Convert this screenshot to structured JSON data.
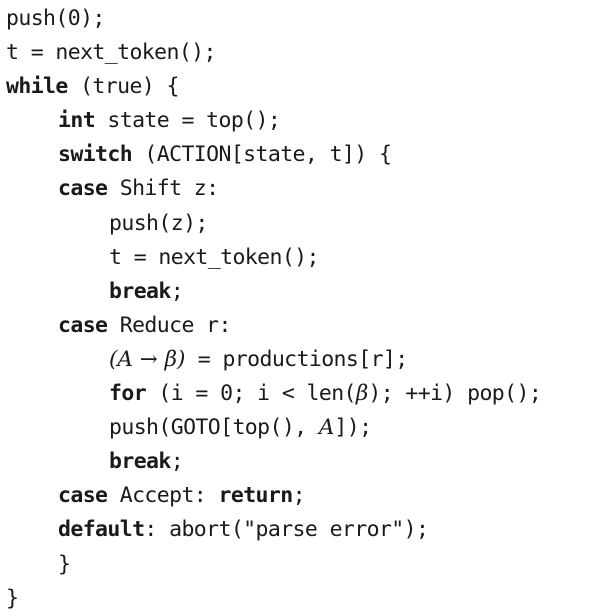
{
  "code": {
    "lines": [
      {
        "indent": 0,
        "tokens": [
          {
            "t": "push(0);"
          }
        ]
      },
      {
        "indent": 0,
        "tokens": [
          {
            "t": "t = next_token();"
          }
        ]
      },
      {
        "indent": 0,
        "tokens": [
          {
            "t": "while",
            "k": "kw"
          },
          {
            "t": " (true) {"
          }
        ]
      },
      {
        "indent": 1,
        "tokens": [
          {
            "t": "int",
            "k": "kw"
          },
          {
            "t": " state = top();"
          }
        ]
      },
      {
        "indent": 1,
        "tokens": [
          {
            "t": "switch",
            "k": "kw"
          },
          {
            "t": " (ACTION[state, t]) {"
          }
        ]
      },
      {
        "indent": 1,
        "tokens": [
          {
            "t": "case",
            "k": "kw"
          },
          {
            "t": " Shift z:"
          }
        ]
      },
      {
        "indent": 2,
        "tokens": [
          {
            "t": "push(z);"
          }
        ]
      },
      {
        "indent": 2,
        "tokens": [
          {
            "t": "t = next_token();"
          }
        ]
      },
      {
        "indent": 2,
        "tokens": [
          {
            "t": "break",
            "k": "kw"
          },
          {
            "t": ";"
          }
        ]
      },
      {
        "indent": 1,
        "tokens": [
          {
            "t": "case",
            "k": "kw"
          },
          {
            "t": " Reduce r:"
          }
        ]
      },
      {
        "indent": 2,
        "tokens": [
          {
            "t": "(A → β)",
            "k": "math"
          },
          {
            "t": " = productions[r];"
          }
        ]
      },
      {
        "indent": 2,
        "tokens": [
          {
            "t": "for",
            "k": "kw"
          },
          {
            "t": " (i = 0; i < len("
          },
          {
            "t": "β",
            "k": "math"
          },
          {
            "t": "); ++i) pop();"
          }
        ]
      },
      {
        "indent": 2,
        "tokens": [
          {
            "t": "push(GOTO[top(), "
          },
          {
            "t": "A",
            "k": "math"
          },
          {
            "t": "]);"
          }
        ]
      },
      {
        "indent": 2,
        "tokens": [
          {
            "t": "break",
            "k": "kw"
          },
          {
            "t": ";"
          }
        ]
      },
      {
        "indent": 1,
        "tokens": [
          {
            "t": "case",
            "k": "kw"
          },
          {
            "t": " Accept: "
          },
          {
            "t": "return",
            "k": "kw"
          },
          {
            "t": ";"
          }
        ]
      },
      {
        "indent": 1,
        "tokens": [
          {
            "t": "default",
            "k": "kw"
          },
          {
            "t": ": abort(\"parse error\");"
          }
        ]
      },
      {
        "indent": 1,
        "tokens": [
          {
            "t": "}"
          }
        ]
      },
      {
        "indent": 0,
        "tokens": [
          {
            "t": "}"
          }
        ]
      }
    ]
  }
}
